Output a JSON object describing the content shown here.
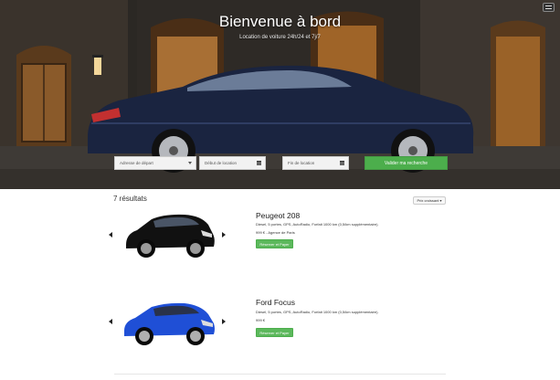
{
  "hero": {
    "title": "Bienvenue à bord",
    "subtitle": "Location de voiture 24h/24 et 7j/7"
  },
  "search": {
    "departure_placeholder": "Adresse de départ",
    "start_placeholder": "Début de location",
    "end_placeholder": "Fin de location",
    "submit_label": "Valider ma recherche"
  },
  "results": {
    "count_label": "7 résultats",
    "sort_label": "Prix croissant ▾"
  },
  "cars": [
    {
      "name": "Peugeot 208",
      "description": "Diesel, 5 portes, GPS, AutoRadio, Forfait 1000 km (0,5/km supplémentaire).",
      "price": "999 € - Agence de Paris",
      "button": "Réserver et Payer",
      "color": "#1a1a1a"
    },
    {
      "name": "Ford Focus",
      "description": "Diesel, 5 portes, GPS, AutoRadio, Forfait 1000 km (0,5/km supplémentaire).",
      "price": "999 €",
      "button": "Réserver et Payer",
      "color": "#1f4fd6"
    }
  ],
  "colors": {
    "accent_green": "#5cb85c",
    "submit_green": "#4cae4c"
  },
  "icons": {
    "menu": "hamburger-menu-icon",
    "calendar": "calendar-icon",
    "prev": "chevron-left-icon",
    "next": "chevron-right-icon"
  }
}
